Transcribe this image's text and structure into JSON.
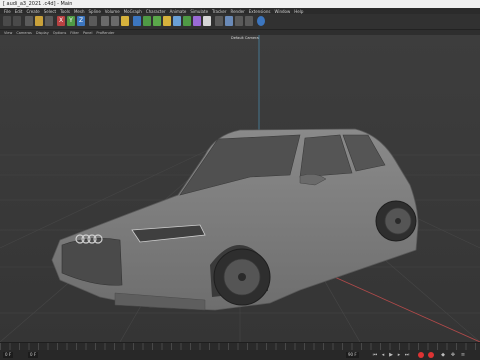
{
  "window": {
    "title": "[ audi_a3_2021 .c4d] - Main"
  },
  "menu": [
    "File",
    "Edit",
    "Create",
    "Select",
    "Tools",
    "Mesh",
    "Spline",
    "Volume",
    "MoGraph",
    "Character",
    "Animate",
    "Simulate",
    "Tracker",
    "Render",
    "Extensions",
    "Window",
    "Help"
  ],
  "toolbar": {
    "x_label": "X",
    "y_label": "Y",
    "z_label": "Z"
  },
  "viewport_menu": [
    "View",
    "Cameras",
    "Display",
    "Options",
    "Filter",
    "Panel",
    "ProRender"
  ],
  "viewport": {
    "camera_label": "Default Camera"
  },
  "timeline": {
    "frame_start": "0 F",
    "frame_current": "0 F",
    "frame_end": "90 F"
  },
  "colors": {
    "accent_yellow": "#d9b13a",
    "accent_red": "#c23b3b",
    "accent_green": "#5aa84a",
    "accent_blue": "#3d7fc8",
    "grid_x_axis": "#b34a4a",
    "grid_z_axis": "#4a8fb3"
  }
}
